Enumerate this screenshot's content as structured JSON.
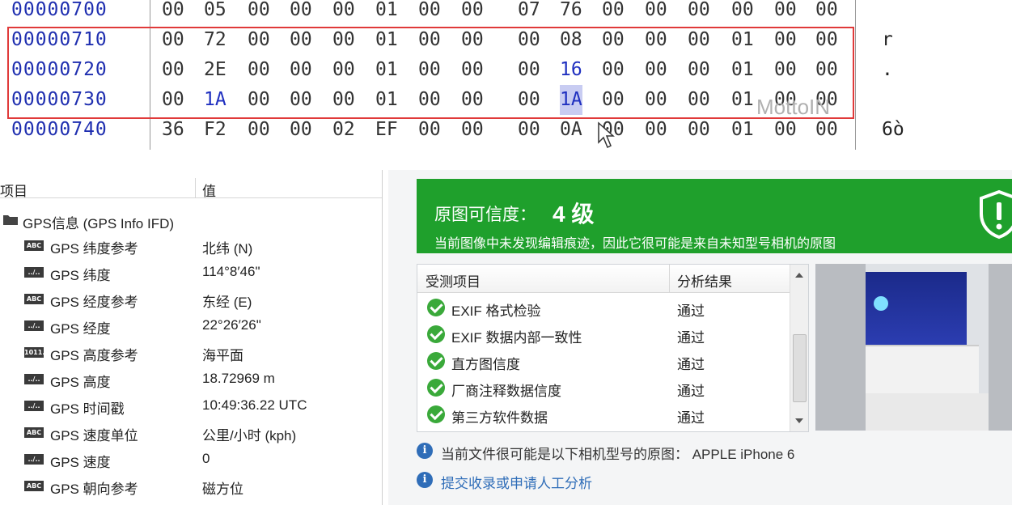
{
  "hex": {
    "rows": [
      {
        "addr": "00000700",
        "bytes": [
          "00",
          "05",
          "00",
          "00",
          "00",
          "01",
          "00",
          "00",
          "07",
          "76",
          "00",
          "00",
          "00",
          "00",
          "00",
          "00"
        ],
        "ascii": ""
      },
      {
        "addr": "00000710",
        "bytes": [
          "00",
          "72",
          "00",
          "00",
          "00",
          "01",
          "00",
          "00",
          "00",
          "08",
          "00",
          "00",
          "00",
          "01",
          "00",
          "00"
        ],
        "ascii": "r"
      },
      {
        "addr": "00000720",
        "bytes": [
          "00",
          "2E",
          "00",
          "00",
          "00",
          "01",
          "00",
          "00",
          "00",
          "16",
          "00",
          "00",
          "00",
          "01",
          "00",
          "00"
        ],
        "ascii": "."
      },
      {
        "addr": "00000730",
        "bytes": [
          "00",
          "1A",
          "00",
          "00",
          "00",
          "01",
          "00",
          "00",
          "00",
          "1A",
          "00",
          "00",
          "00",
          "01",
          "00",
          "00"
        ],
        "ascii": ""
      },
      {
        "addr": "00000740",
        "bytes": [
          "36",
          "F2",
          "00",
          "00",
          "02",
          "EF",
          "00",
          "00",
          "00",
          "0A",
          "00",
          "00",
          "00",
          "01",
          "00",
          "00"
        ],
        "ascii": "6ò"
      }
    ],
    "watermark": "MottoIN"
  },
  "gps": {
    "col_item": "项目",
    "col_value": "值",
    "group": "GPS信息 (GPS Info IFD)",
    "rows": [
      {
        "icon": "ABC",
        "key": "GPS 纬度参考",
        "value": "北纬 (N)"
      },
      {
        "icon": "../..",
        "key": "GPS 纬度",
        "value": "114°8′46\""
      },
      {
        "icon": "ABC",
        "key": "GPS 经度参考",
        "value": "东经 (E)"
      },
      {
        "icon": "../..",
        "key": "GPS 经度",
        "value": "22°26′26\""
      },
      {
        "icon": "1011..",
        "key": "GPS 高度参考",
        "value": "海平面"
      },
      {
        "icon": "../..",
        "key": "GPS 高度",
        "value": "18.72969 m"
      },
      {
        "icon": "../..",
        "key": "GPS 时间戳",
        "value": "10:49:36.22 UTC"
      },
      {
        "icon": "ABC",
        "key": "GPS 速度单位",
        "value": "公里/小时 (kph)"
      },
      {
        "icon": "../..",
        "key": "GPS 速度",
        "value": "0"
      },
      {
        "icon": "ABC",
        "key": "GPS 朝向参考",
        "value": "磁方位"
      }
    ]
  },
  "analysis": {
    "banner_title": "原图可信度：",
    "banner_level": "4 级",
    "banner_sub": "当前图像中未发现编辑痕迹，因此它很可能是来自未知型号相机的原图",
    "banner_color": "#1fa02c",
    "col_item": "受测项目",
    "col_result": "分析结果",
    "rows": [
      {
        "name": "EXIF 格式检验",
        "result": "通过"
      },
      {
        "name": "EXIF 数据内部一致性",
        "result": "通过"
      },
      {
        "name": "直方图信度",
        "result": "通过"
      },
      {
        "name": "厂商注释数据信度",
        "result": "通过"
      },
      {
        "name": "第三方软件数据",
        "result": "通过"
      }
    ],
    "camera_note": "当前文件很可能是以下相机型号的原图： APPLE iPhone 6",
    "submit_link": "提交收录或申请人工分析"
  }
}
